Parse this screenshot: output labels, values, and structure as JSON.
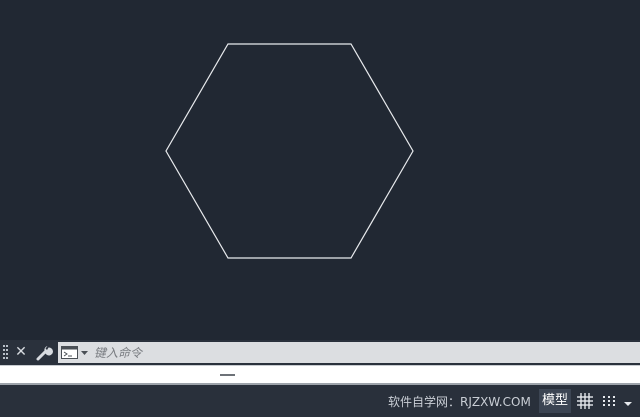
{
  "command_line": {
    "placeholder": "键入命令"
  },
  "status_bar": {
    "watermark": "软件自学网：RJZXW.COM",
    "model_label": "模型"
  },
  "colors": {
    "canvas_bg": "#212833",
    "shape_stroke": "#e8eaed",
    "command_field_bg": "#dcdee1",
    "status_bar_bg": "#29303b"
  },
  "icons": {
    "grip": "grip-icon",
    "close": "close-icon",
    "customize": "wrench-icon",
    "prompt": "command-prompt-icon",
    "grid": "grid-icon",
    "snap": "snap-icon",
    "dropdown": "chevron-down-icon"
  }
}
